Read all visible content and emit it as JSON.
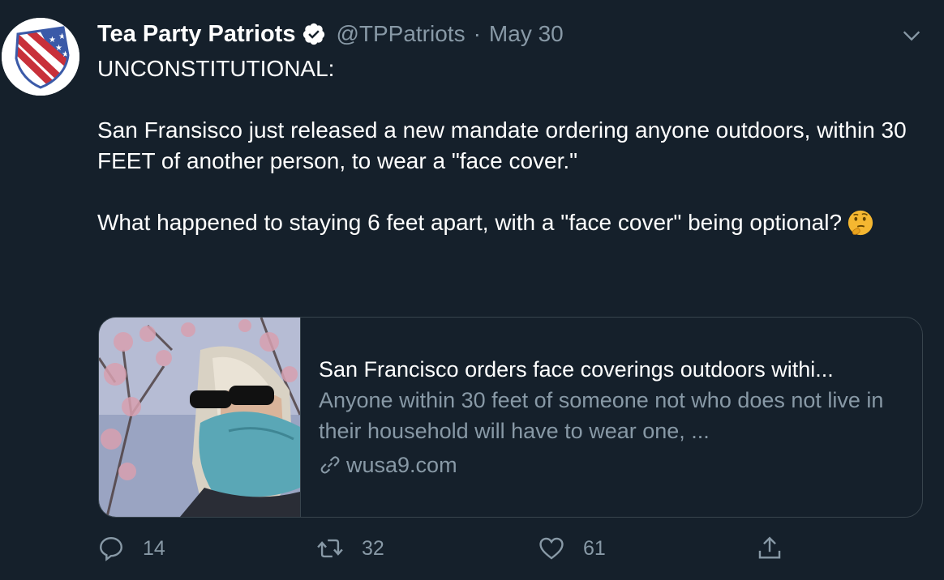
{
  "tweet": {
    "display_name": "Tea Party Patriots",
    "handle": "@TPPatriots",
    "separator": "·",
    "date": "May 30",
    "text_lines": [
      "UNCONSTITUTIONAL:",
      "San Fransisco just released a new mandate ordering anyone outdoors, within 30 FEET of another person, to wear a \"face cover.\"",
      "What happened to staying 6 feet apart, with a \"face cover\" being optional?"
    ],
    "emoji": "thinking-face"
  },
  "card": {
    "title": "San Francisco orders face coverings outdoors withi...",
    "description": "Anyone within 30 feet of someone not who does not live in their household will have to wear one, ...",
    "domain": "wusa9.com"
  },
  "actions": {
    "replies": "14",
    "retweets": "32",
    "likes": "61"
  },
  "colors": {
    "background": "#15202b",
    "secondary_text": "#8899a6",
    "border": "#38444d"
  }
}
